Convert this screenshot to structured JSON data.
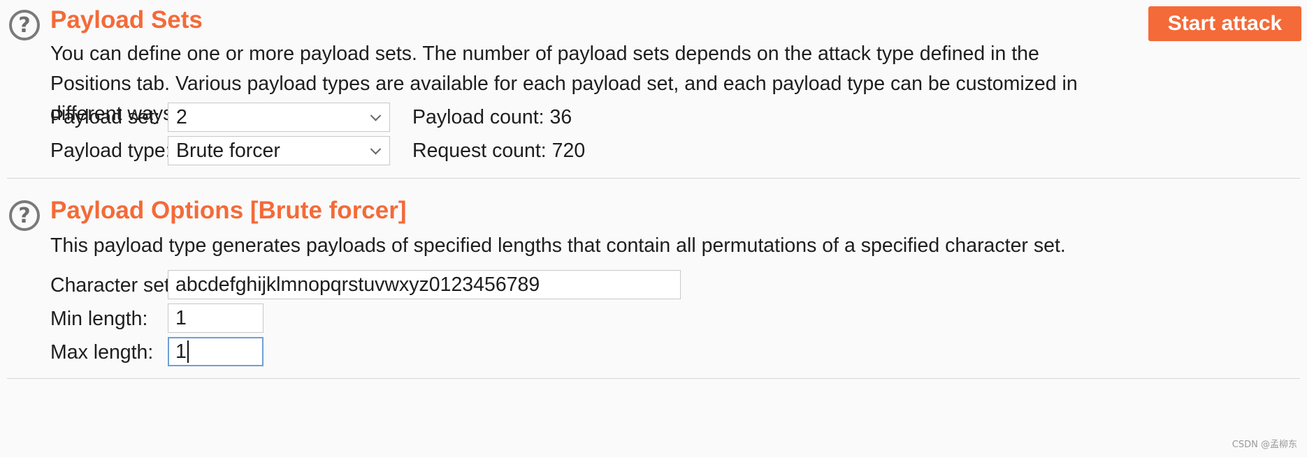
{
  "payload_sets": {
    "title": "Payload Sets",
    "description": "You can define one or more payload sets. The number of payload sets depends on the attack type defined in the Positions tab. Various payload types are available for each payload set, and each payload type can be customized in different ways.",
    "start_attack_label": "Start attack",
    "payload_set_label": "Payload set:",
    "payload_set_value": "2",
    "payload_type_label": "Payload type:",
    "payload_type_value": "Brute forcer",
    "payload_count": "Payload count: 36",
    "request_count": "Request count: 720"
  },
  "payload_options": {
    "title": "Payload Options [Brute forcer]",
    "description": "This payload type generates payloads of specified lengths that contain all permutations of a specified character set.",
    "character_set_label": "Character set:",
    "character_set_value": "abcdefghijklmnopqrstuvwxyz0123456789",
    "min_length_label": "Min length:",
    "min_length_value": "1",
    "max_length_label": "Max length:",
    "max_length_value": "1"
  },
  "help_icon_glyph": "?",
  "watermark": "CSDN @孟柳东",
  "colors": {
    "accent": "#f46a38",
    "focus_border": "#6e9fd8"
  },
  "icons": [
    "help-icon",
    "chevron-down-icon"
  ]
}
